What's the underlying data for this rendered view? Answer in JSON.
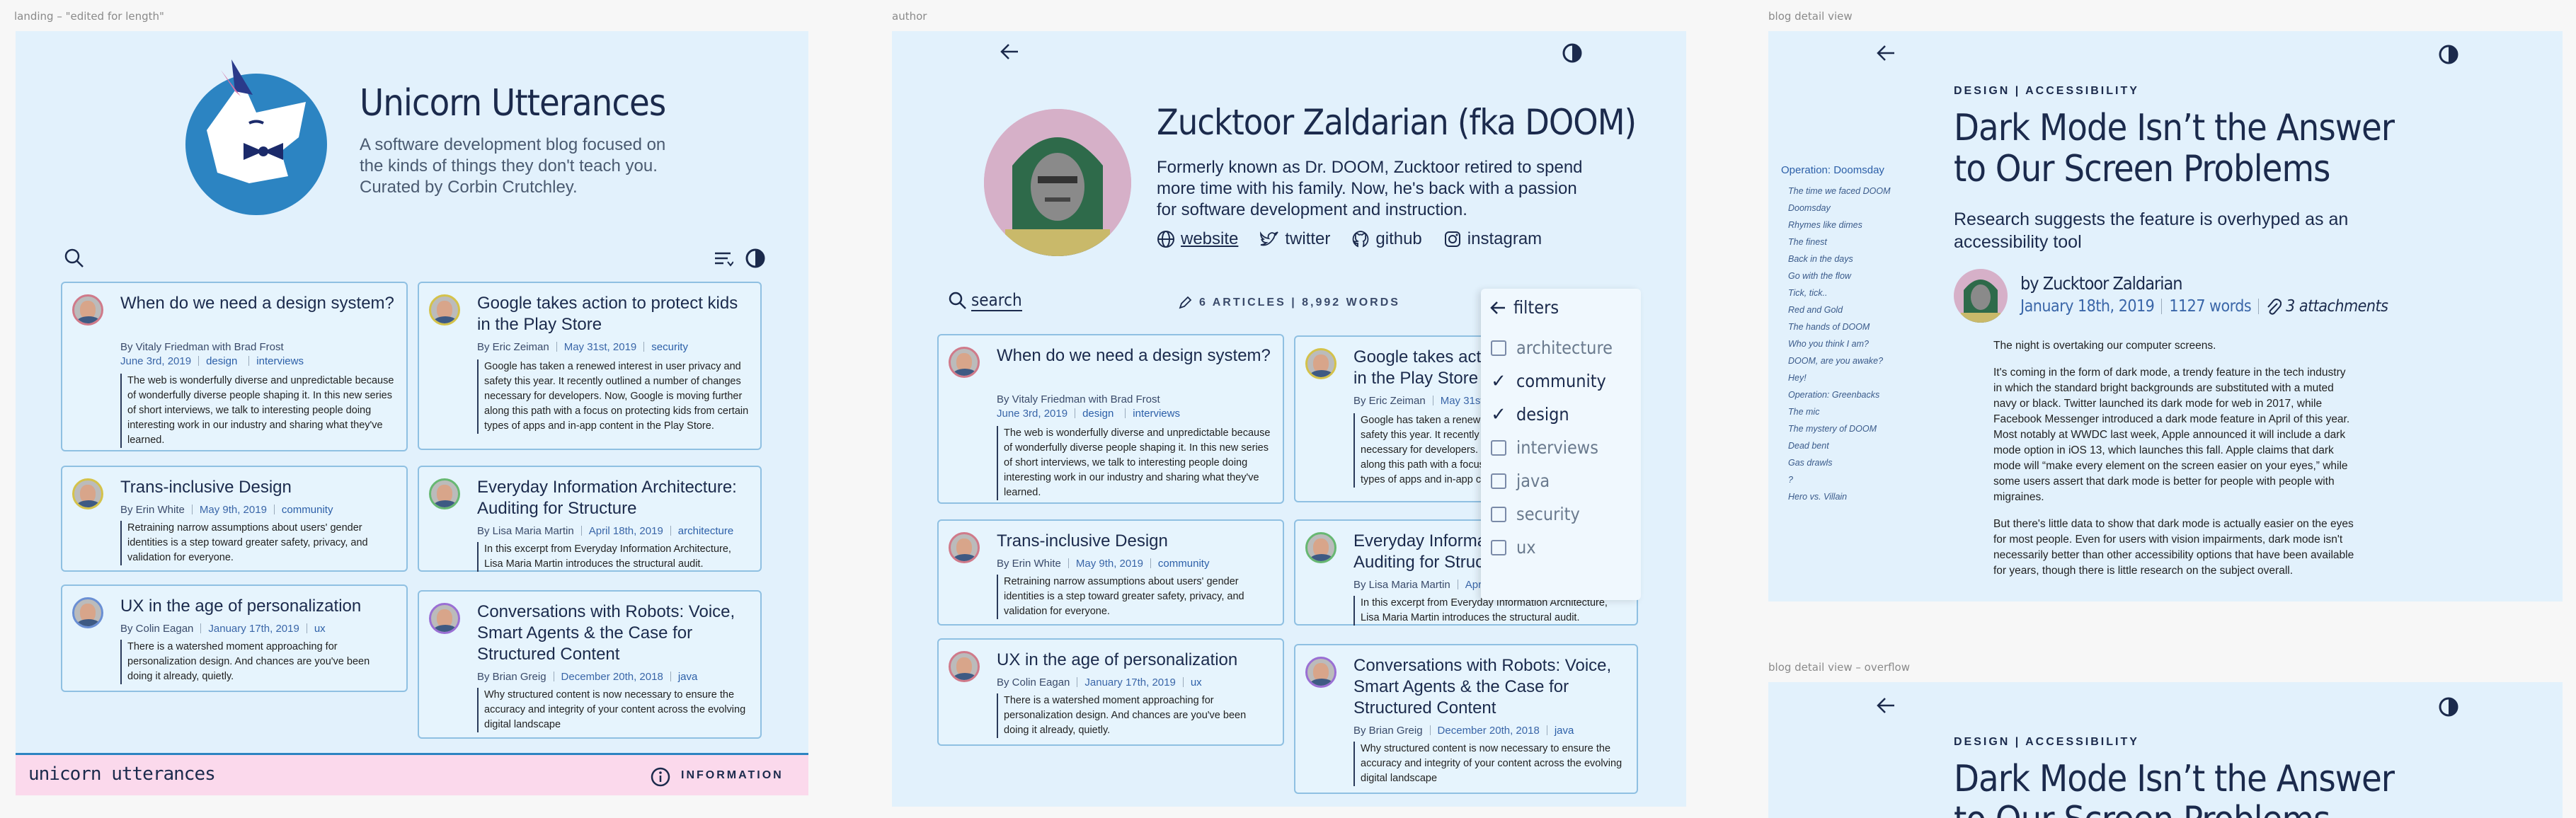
{
  "frames": {
    "landing_label": "landing – \"edited for length\"",
    "author_label": "author",
    "blog_label": "blog detail view",
    "overflow_label": "blog detail view – overflow"
  },
  "site": {
    "title": "Unicorn Utterances",
    "tagline": "A software development blog focused on the kinds of things they don't teach you. Curated by Corbin Crutchley.",
    "footer_brand": "unicorn utterances",
    "footer_info": "INFORMATION"
  },
  "posts": [
    {
      "title": "When do we need a design system?",
      "author": "By Vitaly Friedman with Brad Frost",
      "date": "June 3rd, 2019",
      "tags": [
        "design",
        "interviews"
      ],
      "excerpt": "The web is wonderfully diverse and unpredictable because of wonderfully diverse people shaping it. In this new series of short interviews, we talk to interesting people doing interesting work in our industry and sharing what they've learned."
    },
    {
      "title": "Google takes action to protect kids in the Play Store",
      "author": "By Eric Zeiman",
      "date": "May 31st, 2019",
      "tags": [
        "security"
      ],
      "excerpt": "Google has taken a renewed interest in user privacy and safety this year. It recently outlined a number of changes necessary for developers. Now, Google is moving further along this path with a focus on protecting kids from certain types of apps and in-app content in the Play Store."
    },
    {
      "title": "Trans-inclusive Design",
      "author": "By Erin White",
      "date": "May 9th, 2019",
      "tags": [
        "community"
      ],
      "excerpt": "Retraining narrow assumptions about users' gender identities is a step toward greater safety, privacy, and validation for everyone."
    },
    {
      "title": "Everyday Information Architecture: Auditing for Structure",
      "author": "By Lisa Maria Martin",
      "date": "April 18th, 2019",
      "tags": [
        "architecture"
      ],
      "excerpt": "In this excerpt from Everyday Information Architecture, Lisa Maria Martin introduces the structural audit."
    },
    {
      "title": "UX in the age of personalization",
      "author": "By Colin Eagan",
      "date": "January 17th, 2019",
      "tags": [
        "ux"
      ],
      "excerpt": "There is a watershed moment approaching for personalization design. And chances are you've been doing it already, quietly."
    },
    {
      "title": "Conversations with Robots: Voice, Smart Agents & the Case for Structured Content",
      "author": "By Brian Greig",
      "date": "December 20th, 2018",
      "tags": [
        "java"
      ],
      "excerpt": "Why structured content is now necessary to ensure the accuracy and integrity of your content across the evolving digital landscape"
    }
  ],
  "author": {
    "name": "Zucktoor Zaldarian (fka DOOM)",
    "bio": "Formerly known as Dr. DOOM, Zucktoor retired to spend more time with his family. Now, he's back with a passion for software development and instruction.",
    "links": {
      "website": "website",
      "twitter": "twitter",
      "github": "github",
      "instagram": "instagram"
    },
    "search_label": "search",
    "stats": "6 ARTICLES | 8,992 WORDS",
    "filters_label": "filters",
    "filters": [
      {
        "label": "architecture",
        "checked": false
      },
      {
        "label": "community",
        "checked": true
      },
      {
        "label": "design",
        "checked": true
      },
      {
        "label": "interviews",
        "checked": false
      },
      {
        "label": "java",
        "checked": false
      },
      {
        "label": "security",
        "checked": false
      },
      {
        "label": "ux",
        "checked": false
      }
    ]
  },
  "blog": {
    "tags": "DESIGN | ACCESSIBILITY",
    "title": "Dark Mode Isn’t the Answer to Our Screen Problems",
    "subtitle": "Research suggests the feature is overhyped as an accessibility tool",
    "byline": "by Zucktoor Zaldarian",
    "date": "January 18th, 2019",
    "words": "1127 words",
    "attachments": "3 attachments",
    "toc_title": "Operation: Doomsday",
    "toc": [
      "The time we faced DOOM",
      "Doomsday",
      "Rhymes like dimes",
      "The finest",
      "Back in the days",
      "Go with the flow",
      "Tick, tick..",
      "Red and Gold",
      "The hands of DOOM",
      "Who you think I am?",
      "DOOM, are you awake?",
      "Hey!",
      "Operation: Greenbacks",
      "The mic",
      "The mystery of DOOM",
      "Dead bent",
      "Gas drawls",
      "?",
      "Hero vs. Villain"
    ],
    "p1": "The night is overtaking our computer screens.",
    "p2": "It's coming in the form of dark mode, a trendy feature in the tech industry in which the standard bright backgrounds are substituted with a muted navy or black. Twitter launched its dark mode for web in 2017, while Facebook Messenger introduced a dark mode feature in April of this year. Most notably at WWDC last week, Apple announced it will include a dark mode option in iOS 13, which launches this fall. Apple claims that dark mode will “make every element on the screen easier on your eyes,” while some users assert that dark mode is better for people with people with migraines.",
    "p3": "But there's little data to show that dark mode is actually easier on the eyes for most people. Even for users with vision impairments, dark mode isn't necessarily better than other accessibility options that have been available for years, though there is little research on the subject overall.",
    "overflow_title": "Dark Mode Isn’t the Answer to Our Screen Problems"
  },
  "colors": {
    "frame_bg": "#e2f1fc",
    "accent": "#1b2a4c",
    "footer": "#fbd9ec",
    "logo_blue": "#2c84c2"
  }
}
